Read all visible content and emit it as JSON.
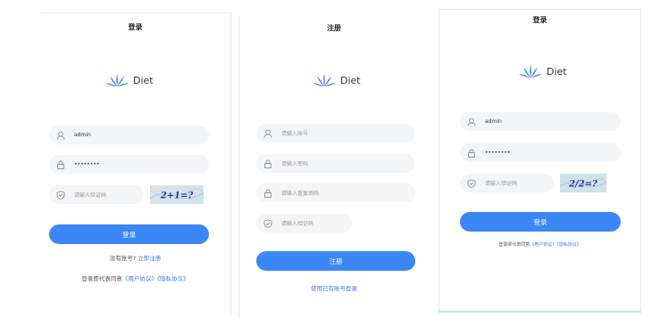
{
  "colors": {
    "accent": "#3b87f5",
    "link": "#3b7ef0",
    "field_bg": "#f4f5f7"
  },
  "login_panel": {
    "title": "登录",
    "logo_text": "Diet",
    "username_value": "admin",
    "password_value": "••••••••",
    "captcha_placeholder": "请输入验证码",
    "captcha_text": "2+1=?",
    "login_button": "登录",
    "no_account_text": "没有账号?",
    "register_link": "立即注册",
    "agreement_prefix": "登录即代表同意",
    "user_agreement": "《用户协议》",
    "privacy_policy": "《隐私协议》"
  },
  "register_panel": {
    "title": "注册",
    "logo_text": "Diet",
    "account_placeholder": "请输入账号",
    "password_placeholder": "请输入密码",
    "confirm_placeholder": "请输入重复密码",
    "captcha_placeholder": "请输入验证码",
    "register_button": "注册",
    "login_link": "使用已有账号登录"
  },
  "login_panel_2": {
    "title": "登录",
    "logo_text": "Diet",
    "username_value": "admin",
    "password_value": "••••••••",
    "captcha_placeholder": "请输入验证码",
    "captcha_text": "2/2=?",
    "login_button": "登录",
    "agreement_prefix": "登录即代表同意",
    "user_agreement": "《用户协议》",
    "privacy_policy": "《隐私协议》"
  }
}
